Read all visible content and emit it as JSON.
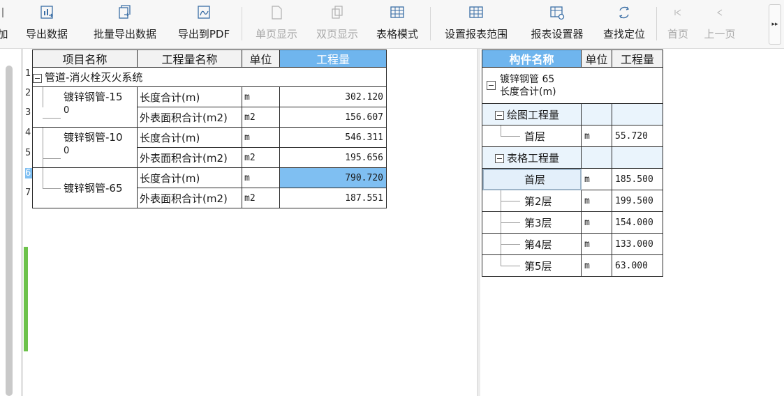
{
  "toolbar": {
    "partial_label": "加",
    "buttons": [
      {
        "label": "导出数据",
        "icon": "export-data-icon",
        "enabled": true
      },
      {
        "label": "批量导出数据",
        "icon": "batch-export-icon",
        "enabled": true
      },
      {
        "label": "导出到PDF",
        "icon": "export-pdf-icon",
        "enabled": true
      },
      {
        "label": "单页显示",
        "icon": "single-page-icon",
        "enabled": false
      },
      {
        "label": "双页显示",
        "icon": "double-page-icon",
        "enabled": false
      },
      {
        "label": "表格模式",
        "icon": "table-mode-icon",
        "enabled": true
      },
      {
        "label": "设置报表范围",
        "icon": "report-range-icon",
        "enabled": true
      },
      {
        "label": "报表设置器",
        "icon": "report-settings-icon",
        "enabled": true
      },
      {
        "label": "查找定位",
        "icon": "find-locate-icon",
        "enabled": true
      },
      {
        "label": "首页",
        "icon": "first-page-icon",
        "enabled": false
      },
      {
        "label": "上一页",
        "icon": "prev-page-icon",
        "enabled": false
      }
    ],
    "more": "▸▸"
  },
  "left_table": {
    "headers": [
      "项目名称",
      "工程量名称",
      "单位",
      "工程量"
    ],
    "row_numbers": [
      "1",
      "2",
      "3",
      "4",
      "5",
      "6",
      "7"
    ],
    "group": "管道-消火栓灭火系统",
    "items": [
      {
        "name": "镀锌钢管-150",
        "name_line1": "镀锌钢管-15",
        "name_line2": "0",
        "rows": [
          {
            "qty_name": "长度合计(m)",
            "unit": "m",
            "value": "302.120"
          },
          {
            "qty_name": "外表面积合计(m2)",
            "unit": "m2",
            "value": "156.607"
          }
        ]
      },
      {
        "name": "镀锌钢管-100",
        "name_line1": "镀锌钢管-10",
        "name_line2": "0",
        "rows": [
          {
            "qty_name": "长度合计(m)",
            "unit": "m",
            "value": "546.311"
          },
          {
            "qty_name": "外表面积合计(m2)",
            "unit": "m2",
            "value": "195.656"
          }
        ]
      },
      {
        "name": "镀锌钢管-65",
        "name_line1": "镀锌钢管-65",
        "name_line2": "",
        "rows": [
          {
            "qty_name": "长度合计(m)",
            "unit": "m",
            "value": "790.720"
          },
          {
            "qty_name": "外表面积合计(m2)",
            "unit": "m2",
            "value": "187.551"
          }
        ]
      }
    ]
  },
  "right_table": {
    "headers": [
      "构件名称",
      "单位",
      "工程量"
    ],
    "title_line1": "镀锌钢管 65",
    "title_line2": "长度合计(m)",
    "drawing_group": "绘图工程量",
    "drawing_rows": [
      {
        "floor": "首层",
        "unit": "m",
        "value": "55.720"
      }
    ],
    "table_group": "表格工程量",
    "table_rows": [
      {
        "floor": "首层",
        "unit": "m",
        "value": "185.500"
      },
      {
        "floor": "第2层",
        "unit": "m",
        "value": "199.500"
      },
      {
        "floor": "第3层",
        "unit": "m",
        "value": "154.000"
      },
      {
        "floor": "第4层",
        "unit": "m",
        "value": "133.000"
      },
      {
        "floor": "第5层",
        "unit": "m",
        "value": "63.000"
      }
    ]
  },
  "colors": {
    "accent": "#6fb5ee",
    "selection": "#7fbff2",
    "green": "#6cc24a"
  }
}
